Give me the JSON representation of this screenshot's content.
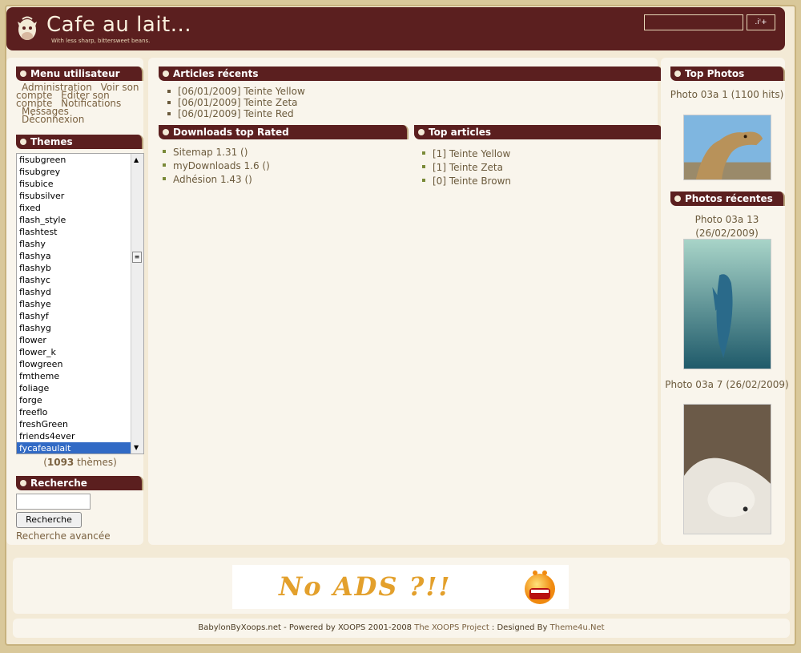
{
  "header": {
    "site_name": "Cafe au lait...",
    "slogan": "With less sharp, bittersweet beans.",
    "search_button": "ꜙ,ı̥̇,ı̇²"
  },
  "user_menu": {
    "title": "Menu utilisateur",
    "items": [
      "Administration",
      "Voir son compte",
      "Editer son compte",
      "Notifications",
      "Messages",
      "Déconnexion"
    ]
  },
  "themes": {
    "title": "Themes",
    "options": [
      "fisubgreen",
      "fisubgrey",
      "fisubice",
      "fisubsilver",
      "fixed",
      "flash_style",
      "flashtest",
      "flashy",
      "flashya",
      "flashyb",
      "flashyc",
      "flashyd",
      "flashye",
      "flashyf",
      "flashyg",
      "flower",
      "flower_k",
      "flowgreen",
      "fmtheme",
      "foliage",
      "forge",
      "freeflo",
      "freshGreen",
      "friends4ever",
      "fycafeaulait"
    ],
    "selected": "fycafeaulait",
    "count_open": "(",
    "count": "1093",
    "count_suffix": " thèmes)"
  },
  "search": {
    "title": "Recherche",
    "button": "Recherche",
    "advanced": "Recherche avancée"
  },
  "articles_recent": {
    "title": "Articles récents",
    "items": [
      "[06/01/2009] Teinte Yellow",
      "[06/01/2009] Teinte Zeta",
      "[06/01/2009] Teinte Red"
    ]
  },
  "downloads_top": {
    "title": "Downloads top Rated",
    "items": [
      "Sitemap 1.31 ()",
      "myDownloads 1.6 ()",
      "Adhésion 1.43 ()"
    ]
  },
  "top_articles": {
    "title": "Top articles",
    "items": [
      "[1] Teinte Yellow",
      "[1] Teinte Zeta",
      "[0] Teinte Brown"
    ]
  },
  "top_photos": {
    "title": "Top Photos",
    "caption": "Photo 03a 1 (1100 hits)"
  },
  "recent_photos": {
    "title": "Photos récentes",
    "captions": [
      "Photo 03a 13 (26/02/2009)",
      "Photo 03a 7 (26/02/2009)"
    ]
  },
  "ad": {
    "text": "No ADS ?!!"
  },
  "footer": {
    "text1": "BabylonByXoops.net - Powered by XOOPS 2001-2008 ",
    "link1": "The XOOPS Project",
    "text2": " : Designed By ",
    "link2": "Theme4u.Net"
  },
  "colors": {
    "header_bg": "#5b1f1f",
    "page_bg": "#f3ead6",
    "accent": "#e3a02c"
  }
}
